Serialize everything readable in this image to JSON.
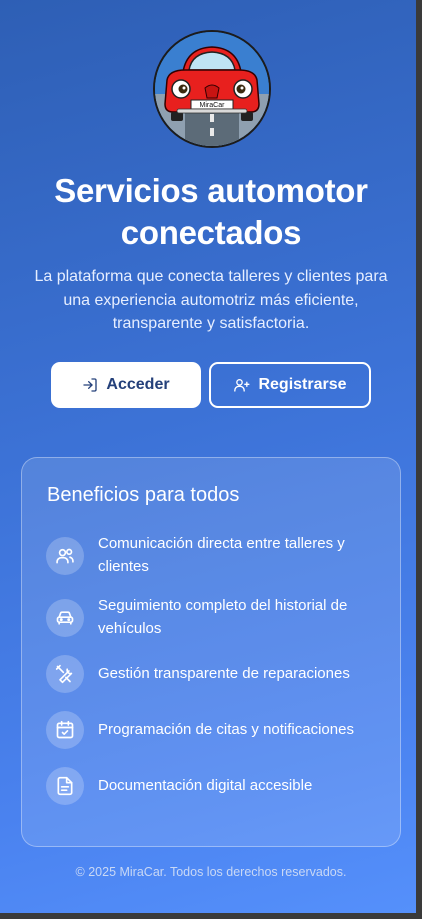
{
  "hero": {
    "logo_alt": "MiraCar",
    "plate_text": "MiraCar",
    "title_line1": "Servicios automotor",
    "title_line2": "conectados",
    "subtitle_line1": "La plataforma que conecta talleres y clientes para",
    "subtitle_line2": "una experiencia automotriz más eficiente,",
    "subtitle_line3": "transparente y satisfactoria."
  },
  "actions": {
    "login_label": "Acceder",
    "register_label": "Registrarse"
  },
  "benefits": {
    "title": "Beneficios para todos",
    "items": [
      {
        "icon": "users-icon",
        "line1": "Comunicación directa entre talleres y",
        "line2": "clientes"
      },
      {
        "icon": "car-icon",
        "line1": "Seguimiento completo del historial de",
        "line2": "vehículos"
      },
      {
        "icon": "tools-icon",
        "line1": "Gestión transparente de reparaciones",
        "line2": ""
      },
      {
        "icon": "calendar-check-icon",
        "line1": "Programación de citas y notificaciones",
        "line2": ""
      },
      {
        "icon": "document-icon",
        "line1": "Documentación digital accesible",
        "line2": ""
      }
    ]
  },
  "footer": {
    "copyright": "© 2025 MiraCar. Todos los derechos reservados."
  },
  "colors": {
    "gradient_start": "#2e5fb5",
    "gradient_end": "#5590fb",
    "primary_button_text": "#24407a",
    "car_red": "#e8201e"
  }
}
